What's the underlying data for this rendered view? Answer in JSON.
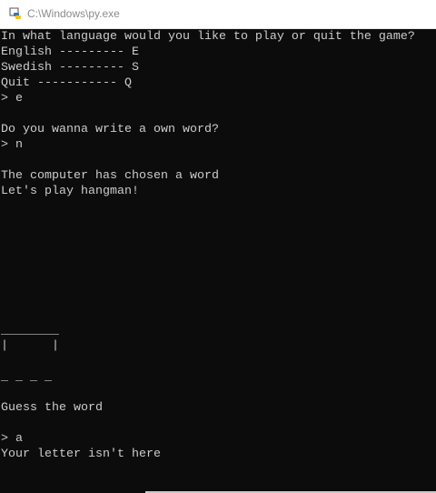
{
  "window": {
    "title": "C:\\Windows\\py.exe",
    "icon": "python-launcher-icon"
  },
  "console": {
    "lines": [
      "In what language would you like to play or quit the game?",
      "English --------- E",
      "Swedish --------- S",
      "Quit ----------- Q",
      "> e",
      "",
      "Do you wanna write a own word?",
      "> n",
      "",
      "The computer has chosen a word",
      "Let's play hangman!",
      "",
      "",
      "",
      "",
      "",
      "",
      "",
      "",
      "________",
      "|      |",
      "",
      "_ _ _ _",
      "",
      "Guess the word",
      "",
      "> a",
      "Your letter isn't here"
    ]
  },
  "colors": {
    "background": "#0c0c0c",
    "text": "#cccccc"
  }
}
